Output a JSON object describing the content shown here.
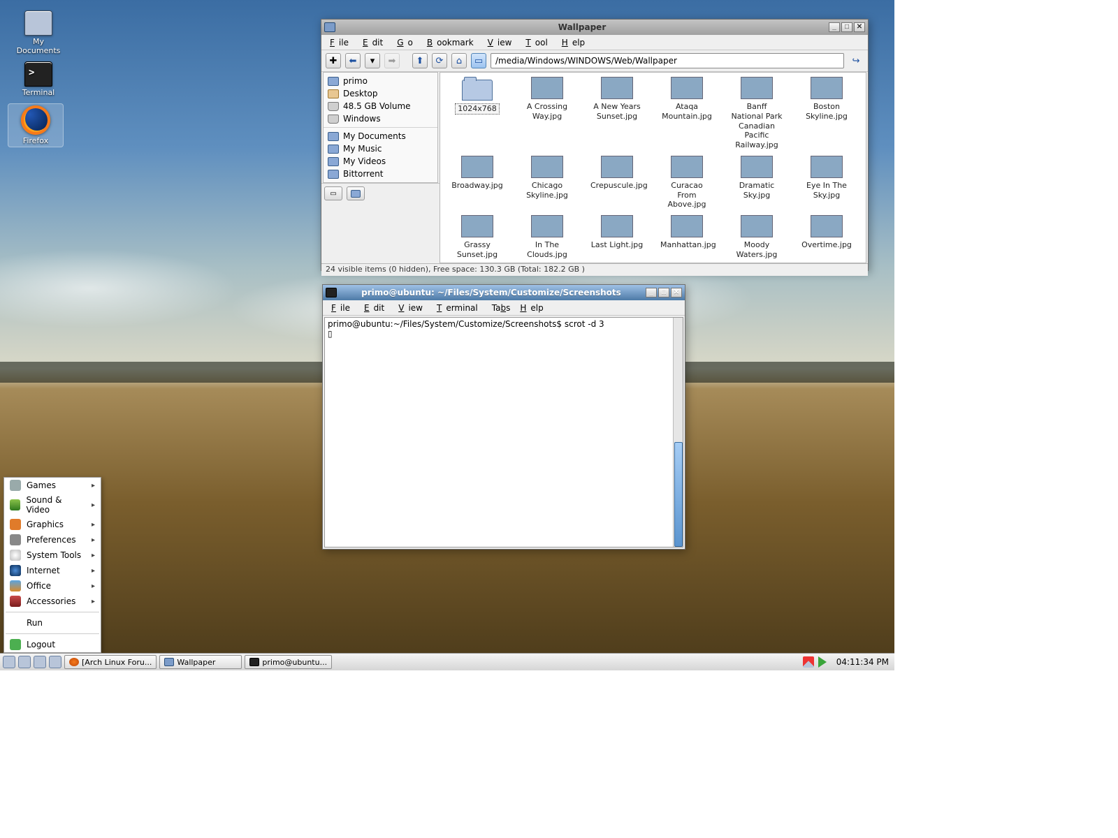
{
  "desktop_icons": {
    "documents": "My\nDocuments",
    "terminal": "Terminal",
    "firefox": "Firefox"
  },
  "fm": {
    "title": "Wallpaper",
    "menu": {
      "file": "File",
      "edit": "Edit",
      "go": "Go",
      "bookmark": "Bookmark",
      "view": "View",
      "tool": "Tool",
      "help": "Help"
    },
    "path": "/media/Windows/WINDOWS/Web/Wallpaper",
    "tree": {
      "primo": "primo",
      "desktop": "Desktop",
      "vol": "48.5 GB Volume",
      "windows": "Windows",
      "mydocs": "My Documents",
      "mymusic": "My Music",
      "myvideos": "My Videos",
      "bt": "Bittorrent"
    },
    "rows": [
      [
        "1024x768",
        "A Crossing Way.jpg",
        "A New Years Sunset.jpg",
        "Ataqa Mountain.jpg",
        "Banff National Park Canadian Pacific Railway.jpg",
        "Boston Skyline.jpg"
      ],
      [
        "Broadway.jpg",
        "Chicago Skyline.jpg",
        "Crepuscule.jpg",
        "Curacao From Above.jpg",
        "Dramatic Sky.jpg",
        "Eye In The Sky.jpg"
      ],
      [
        "Grassy Sunset.jpg",
        "In The Clouds.jpg",
        "Last Light.jpg",
        "Manhattan.jpg",
        "Moody Waters.jpg",
        "Overtime.jpg"
      ]
    ],
    "status": "24 visible items (0 hidden), Free space: 130.3 GB (Total: 182.2 GB )"
  },
  "term": {
    "title": "primo@ubuntu: ~/Files/System/Customize/Screenshots",
    "menu": {
      "file": "File",
      "edit": "Edit",
      "view": "View",
      "terminal": "Terminal",
      "tabs": "Tabs",
      "help": "Help"
    },
    "prompt": "primo@ubuntu:~/Files/System/Customize/Screenshots$ scrot -d 3",
    "cursor": "▯"
  },
  "appmenu": {
    "games": "Games",
    "sound": "Sound & Video",
    "graphics": "Graphics",
    "prefs": "Preferences",
    "systools": "System Tools",
    "internet": "Internet",
    "office": "Office",
    "acc": "Accessories",
    "run": "Run",
    "logout": "Logout"
  },
  "taskbar": {
    "t1": "[Arch Linux Foru...",
    "t2": "Wallpaper",
    "t3": "primo@ubuntu...",
    "clock": "04:11:34 PM"
  },
  "winbtn": {
    "min": "_",
    "max": "□",
    "close": "✕"
  }
}
